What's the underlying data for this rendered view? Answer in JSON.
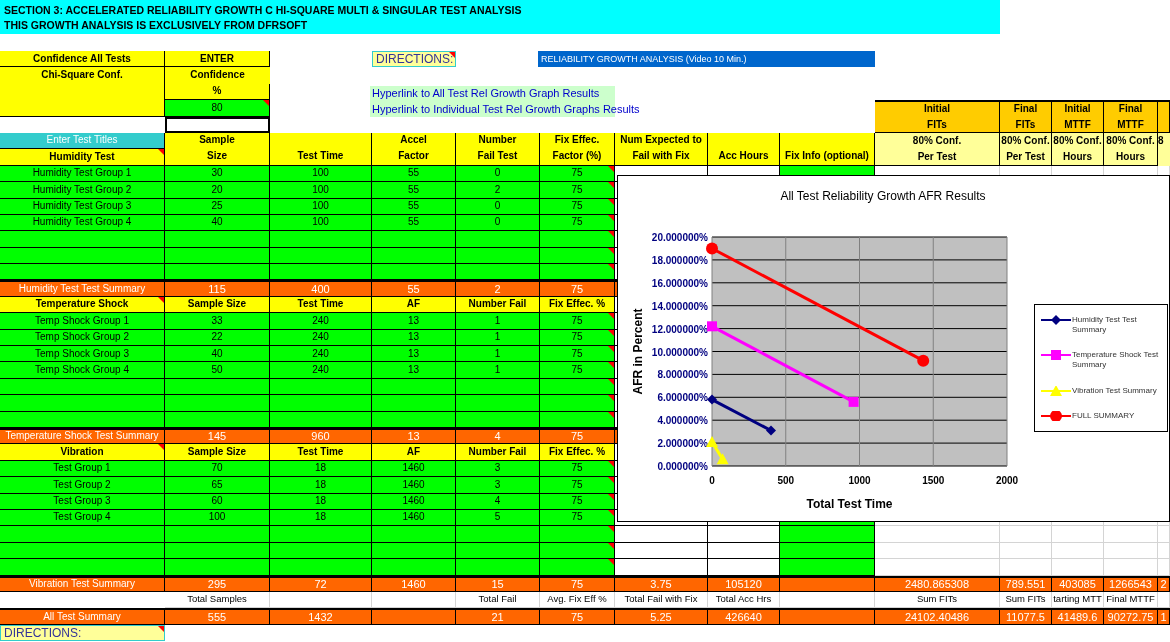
{
  "banner": {
    "lines": [
      "SECTION 3: ACCELERATED RELIABILITY GROWTH C HI-SQUARE MULTI & SINGULAR TEST ANALYSIS",
      "THIS GROWTH ANALYSIS IS EXCLUSIVELY FROM DFRSOFT"
    ]
  },
  "confidence": {
    "label": "Confidence All Tests",
    "sublabel": "Chi-Square Conf.",
    "enter": "ENTER",
    "confidence_label": "Confidence",
    "percent": "%",
    "value": "80",
    "has_comment": true
  },
  "directions_top": {
    "text": "DIRECTIONS:",
    "has_comment": true
  },
  "video_link": "RELIABILITY GROWTH ANALYSIS (Video 10 Min.)",
  "hyperlinks": [
    "Hyperlink to All Test Rel Growth Graph Results",
    "Hyperlink to Individual Test Rel Growth Graphs Results"
  ],
  "right_headers": [
    {
      "top": "Initial\nFITs",
      "sub": "80% Conf.\nPer Test"
    },
    {
      "top": "Final\nFITs",
      "sub": "80% Conf.\nPer Test"
    },
    {
      "top": "Initial\nMTTF",
      "sub": "80% Conf.\nHours"
    },
    {
      "top": "Final\nMTTF",
      "sub": "80% Conf.\nHours"
    },
    {
      "sub": "8"
    }
  ],
  "enter_titles": "Enter Test Titles",
  "columns": [
    "Sample\nSize",
    "Test Time",
    "Accel\nFactor",
    "Number\nFail Test",
    "Fix Effec.\nFactor (%)",
    "Num Expected to\nFail with Fix",
    "Acc Hours",
    "Fix Info (optional)"
  ],
  "groups": [
    {
      "title": "Humidity Test",
      "title_comment": true,
      "fix_comments": true,
      "rows": [
        [
          "Humidity Test Group 1",
          "30",
          "100",
          "55",
          "0",
          "75"
        ],
        [
          "Humidity Test Group 2",
          "20",
          "100",
          "55",
          "2",
          "75"
        ],
        [
          "Humidity Test Group 3",
          "25",
          "100",
          "55",
          "0",
          "75"
        ],
        [
          "Humidity Test Group 4",
          "40",
          "100",
          "55",
          "0",
          "75"
        ]
      ],
      "summary": {
        "label": "Humidity Test Test Summary",
        "sample_size": "115",
        "test_time": "400",
        "af": "55",
        "fails": "2",
        "fix_effect": "75"
      }
    },
    {
      "title": "Temperature Shock",
      "title_comment": true,
      "fix_comments": true,
      "headers": [
        "Sample Size",
        "Test Time",
        "AF",
        "Number Fail",
        "Fix Effec. %"
      ],
      "rows": [
        [
          "Temp Shock Group 1",
          "33",
          "240",
          "13",
          "1",
          "75"
        ],
        [
          "Temp Shock Group 2",
          "22",
          "240",
          "13",
          "1",
          "75"
        ],
        [
          "Temp Shock Group 3",
          "40",
          "240",
          "13",
          "1",
          "75"
        ],
        [
          "Temp Shock Group 4",
          "50",
          "240",
          "13",
          "1",
          "75"
        ]
      ],
      "summary": {
        "label": "Temperature Shock Test Summary",
        "sample_size": "145",
        "test_time": "960",
        "af": "13",
        "fails": "4",
        "fix_effect": "75"
      }
    },
    {
      "title": "Vibration",
      "title_comment": true,
      "fix_comments": true,
      "headers": [
        "Sample Size",
        "Test Time",
        "AF",
        "Number Fail",
        "Fix Effec. %"
      ],
      "rows": [
        [
          "Test Group 1",
          "70",
          "18",
          "1460",
          "3",
          "75"
        ],
        [
          "Test Group 2",
          "65",
          "18",
          "1460",
          "3",
          "75"
        ],
        [
          "Test Group 3",
          "60",
          "18",
          "1460",
          "4",
          "75"
        ],
        [
          "Test Group 4",
          "100",
          "18",
          "1460",
          "5",
          "75"
        ]
      ],
      "summary": {
        "label": "Vibration Test Summary",
        "sample_size": "295",
        "test_time": "72",
        "af": "1460",
        "fails": "15",
        "fix_effect": "75",
        "expected_fails": "3.75",
        "acc_hours": "105120",
        "initial_fits": "2480.865308",
        "final_fits": "789.551",
        "initial_mttf": "403085",
        "final_mttf": "1266543",
        "column_14": "2"
      }
    }
  ],
  "total_labels": {
    "sample_size": "Total Samples",
    "fails": "Total Fail",
    "fix_effect": "Avg. Fix Eff %",
    "expected_fails": "Total Fail with Fix",
    "acc_hours": "Total Acc Hrs",
    "initial_fits": "Sum FITs",
    "final_fits": "Sum FITs",
    "initial_mttf": "tarting MTT",
    "final_mttf": "Final MTTF"
  },
  "all_summary": {
    "label": "All Test Summary",
    "sample_size": "555",
    "test_time": "1432",
    "fails": "21",
    "fix_effect": "75",
    "expected_fails": "5.25",
    "acc_hours": "426640",
    "initial_fits": "24102.40486",
    "final_fits": "11077.5",
    "initial_mttf": "41489.6",
    "final_mttf": "90272.75",
    "column_14": "1"
  },
  "directions_bottom": {
    "text": "DIRECTIONS:",
    "has_comment": true
  },
  "chart": {
    "chart_data": {
      "type": "line",
      "title": "All Test Reliability Growth AFR Results",
      "xlabel": "Total Test Time",
      "ylabel": "AFR in Percent",
      "xlim": [
        0,
        2000
      ],
      "ylim": [
        0,
        20
      ],
      "xticks": [
        0,
        500,
        1000,
        1500,
        2000
      ],
      "yticks": [
        {
          "value": 0,
          "label": "0.000000%"
        },
        {
          "value": 2,
          "label": "2.000000%"
        },
        {
          "value": 4,
          "label": "4.000000%"
        },
        {
          "value": 6,
          "label": "6.000000%"
        },
        {
          "value": 8,
          "label": "8.000000%"
        },
        {
          "value": 10,
          "label": "10.000000%"
        },
        {
          "value": 12,
          "label": "12.000000%"
        },
        {
          "value": 14,
          "label": "14.000000%"
        },
        {
          "value": 16,
          "label": "16.000000%"
        },
        {
          "value": 18,
          "label": "18.000000%"
        },
        {
          "value": 20,
          "label": "20.000000%"
        }
      ],
      "grid": true,
      "legend": true,
      "series": [
        {
          "name": "Humidity Test Test Summary",
          "color": "#000080",
          "marker": "diamond",
          "x": [
            0,
            400
          ],
          "values": [
            5.8,
            3.1
          ]
        },
        {
          "name": "Temperature Shock Test Summary",
          "color": "#ff00ff",
          "marker": "square",
          "x": [
            0,
            960
          ],
          "values": [
            12.2,
            5.6
          ]
        },
        {
          "name": "Vibration Test Summary",
          "color": "#ffff00",
          "marker": "triangle",
          "x": [
            0,
            72
          ],
          "values": [
            2.1,
            0.6
          ]
        },
        {
          "name": "FULL SUMMARY",
          "color": "#ff0000",
          "marker": "circle",
          "x": [
            0,
            1432
          ],
          "values": [
            19.0,
            9.2
          ]
        }
      ]
    }
  }
}
